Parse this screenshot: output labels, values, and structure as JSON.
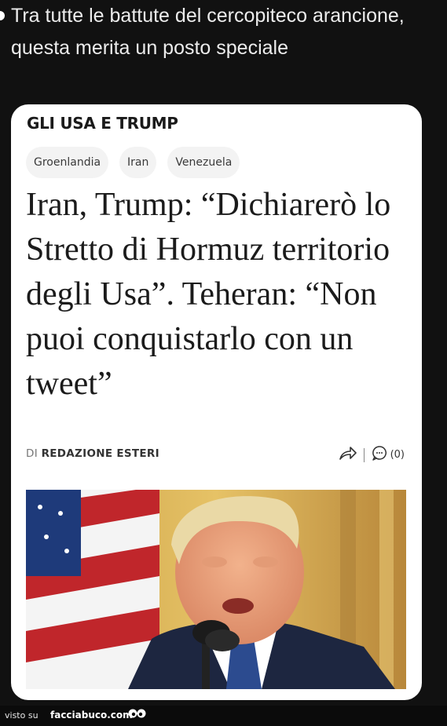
{
  "caption": "Tra tutte le battute del cercopiteco arancione, questa merita un posto speciale",
  "article": {
    "section": "GLI USA E TRUMP",
    "tags": [
      "Groenlandia",
      "Iran",
      "Venezuela"
    ],
    "headline": "Iran, Trump: “Dichiarerò lo Stretto di Hormuz territorio degli Usa”. Teheran: “Non puoi conquistarlo con un tweet”",
    "byline_prefix": "DI",
    "author": "REDAZIONE ESTERI",
    "comment_count": "(0)"
  },
  "icons": {
    "share": "share-arrow-icon",
    "comments": "comment-bubble-icon"
  },
  "footer": {
    "visto": "visto su",
    "site": "facciabuco.com"
  },
  "colors": {
    "background": "#111111",
    "card": "#ffffff",
    "tag_bg": "#f3f3f3"
  }
}
